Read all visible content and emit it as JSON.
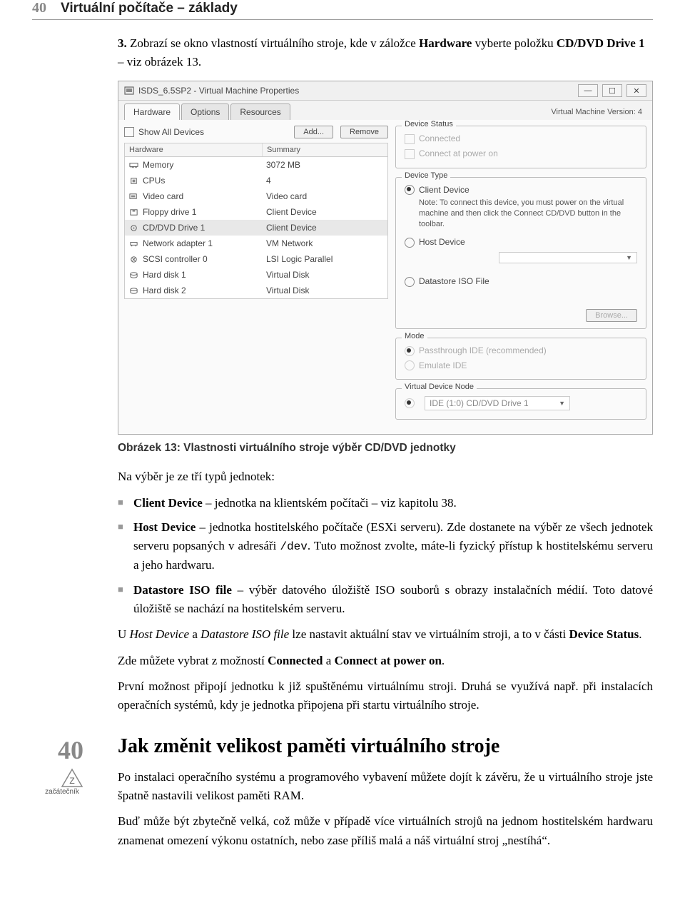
{
  "header": {
    "page_number": "40",
    "title": "Virtuální počítače – základy"
  },
  "intro_item": {
    "number": "3.",
    "text_a": "Zobrazí se okno vlastností virtuálního stroje, kde v záložce ",
    "bold_a": "Hardware",
    "text_b": " vyberte položku ",
    "bold_b": "CD/DVD Drive 1",
    "text_c": " – viz obrázek 13."
  },
  "dialog": {
    "window_title": "ISDS_6.5SP2 - Virtual Machine Properties",
    "vm_version": "Virtual Machine Version: 4",
    "tabs": [
      "Hardware",
      "Options",
      "Resources"
    ],
    "show_all": "Show All Devices",
    "add_btn": "Add...",
    "remove_btn": "Remove",
    "hw_headers": {
      "c1": "Hardware",
      "c2": "Summary"
    },
    "rows": [
      {
        "name": "Memory",
        "summary": "3072 MB"
      },
      {
        "name": "CPUs",
        "summary": "4"
      },
      {
        "name": "Video card",
        "summary": "Video card"
      },
      {
        "name": "Floppy drive 1",
        "summary": "Client Device"
      },
      {
        "name": "CD/DVD Drive 1",
        "summary": "Client Device",
        "selected": true
      },
      {
        "name": "Network adapter 1",
        "summary": "VM Network"
      },
      {
        "name": "SCSI controller 0",
        "summary": "LSI Logic Parallel"
      },
      {
        "name": "Hard disk 1",
        "summary": "Virtual Disk"
      },
      {
        "name": "Hard disk 2",
        "summary": "Virtual Disk"
      }
    ],
    "device_status": {
      "title": "Device Status",
      "connected": "Connected",
      "connect_power": "Connect at power on"
    },
    "device_type": {
      "title": "Device Type",
      "client": "Client Device",
      "client_note": "Note: To connect this device, you must power on the virtual machine and then click the Connect CD/DVD button in the toolbar.",
      "host": "Host Device",
      "iso": "Datastore ISO File",
      "browse": "Browse..."
    },
    "mode": {
      "title": "Mode",
      "passthrough": "Passthrough IDE (recommended)",
      "emulate": "Emulate IDE"
    },
    "vdn": {
      "title": "Virtual Device Node",
      "value": "IDE (1:0) CD/DVD Drive 1"
    }
  },
  "caption": "Obrázek 13: Vlastnosti virtuálního stroje výběr CD/DVD jednotky",
  "body1": "Na výběr je ze tří typů jednotek:",
  "bullets": {
    "b1_a": "Client Device",
    "b1_b": " – jednotka na klientském počítači – viz kapitolu 38.",
    "b2_a": "Host Device",
    "b2_b": " – jednotka hostitelského počítače (ESXi serveru). Zde dostanete na výběr ze všech jednotek serveru popsaných v adresáři ",
    "b2_code": "/dev",
    "b2_c": ". Tuto možnost zvolte, máte-li fyzický přístup k hostitelskému serveru a jeho hardwaru.",
    "b3_a": "Datastore ISO file",
    "b3_b": " – výběr datového úložiště ISO souborů s obrazy instalačních médií. Toto datové úložiště se nachází na hostitelském serveru."
  },
  "para1_a": "U ",
  "para1_i1": "Host Device",
  "para1_b": " a ",
  "para1_i2": "Datastore ISO file",
  "para1_c": " lze nastavit aktuální stav ve virtuálním stroji, a to v části ",
  "para1_bold": "Device Status",
  "para1_d": ".",
  "para2_a": "Zde můžete vybrat z možností ",
  "para2_b1": "Connected",
  "para2_b": " a ",
  "para2_b2": "Connect at power on",
  "para2_c": ".",
  "para3": "První možnost připojí jednotku k již spuštěnému virtuálnímu stroji. Druhá se využívá např. při instalacích operačních systémů, kdy je jednotka připojena při startu virtuálního stroje.",
  "section": {
    "number": "40",
    "badge": "začátečník",
    "title": "Jak změnit velikost paměti virtuálního stroje",
    "p1": "Po instalaci operačního systému a programového vybavení můžete dojít k závěru, že u virtuálního stroje jste špatně nastavili velikost paměti RAM.",
    "p2": "Buď může být zbytečně velká, což může v případě více virtuálních strojů na jednom hostitelském hardwaru znamenat omezení výkonu ostatních, nebo zase příliš malá a náš virtuální stroj „nestíhá“."
  }
}
